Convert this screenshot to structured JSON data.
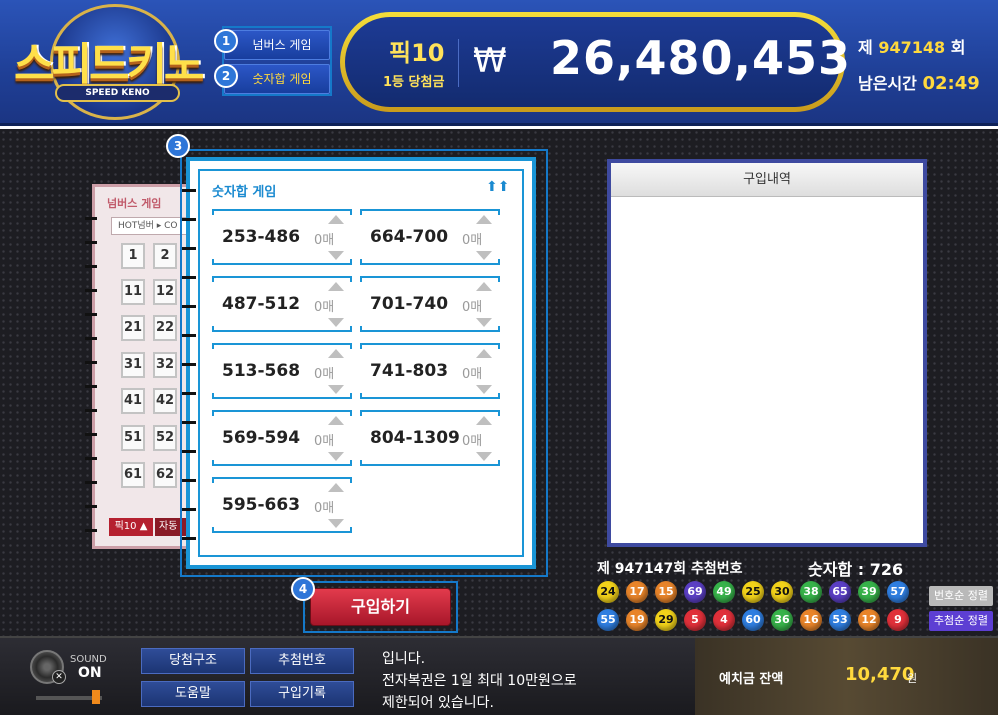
{
  "header": {
    "logo_title": "스피드키노",
    "logo_sub": "SPEED KENO",
    "modes": [
      {
        "badge": "1",
        "label": "넘버스 게임",
        "active": false
      },
      {
        "badge": "2",
        "label": "숫자합 게임",
        "active": true
      }
    ],
    "jackpot": {
      "label": "픽10",
      "sub_label": "1등 당첨금",
      "currency": "₩",
      "amount": "26,480,453"
    },
    "round_prefix": "제",
    "round_number": "947148",
    "round_suffix": "회",
    "time_label": "남은시간",
    "time_value": "02:49"
  },
  "number_slip": {
    "title": "넘버스 게임",
    "tab": "HOT넘버 ▸  CO",
    "rows": [
      [
        "1",
        "2"
      ],
      [
        "11",
        "12"
      ],
      [
        "21",
        "22"
      ],
      [
        "31",
        "32"
      ],
      [
        "41",
        "42"
      ],
      [
        "51",
        "52"
      ],
      [
        "61",
        "62"
      ]
    ],
    "foot_left": "픽10 ▲",
    "foot_right": "자동"
  },
  "sum_slip": {
    "badge": "3",
    "title": "숫자합 게임",
    "arrows": "⬆⬆",
    "count_suffix": "매",
    "ranges": [
      {
        "label": "253-486",
        "count": "0"
      },
      {
        "label": "664-700",
        "count": "0"
      },
      {
        "label": "487-512",
        "count": "0"
      },
      {
        "label": "701-740",
        "count": "0"
      },
      {
        "label": "513-568",
        "count": "0"
      },
      {
        "label": "741-803",
        "count": "0"
      },
      {
        "label": "569-594",
        "count": "0"
      },
      {
        "label": "804-1309",
        "count": "0"
      },
      {
        "label": "595-663",
        "count": "0"
      }
    ]
  },
  "buy": {
    "badge": "4",
    "label": "구입하기"
  },
  "history": {
    "title": "구입내역"
  },
  "draw": {
    "title": "제 947147회 추첨번호",
    "sum_label": "숫자합 : 726",
    "row1": [
      {
        "n": "24",
        "color": "#f2d21a"
      },
      {
        "n": "17",
        "color": "#e8842a"
      },
      {
        "n": "15",
        "color": "#e8842a"
      },
      {
        "n": "69",
        "color": "#5b3fc4"
      },
      {
        "n": "49",
        "color": "#37b24a"
      },
      {
        "n": "25",
        "color": "#f2d21a"
      },
      {
        "n": "30",
        "color": "#f2d21a"
      },
      {
        "n": "38",
        "color": "#37b24a"
      },
      {
        "n": "65",
        "color": "#5b3fc4"
      },
      {
        "n": "39",
        "color": "#37b24a"
      },
      {
        "n": "57",
        "color": "#2f7ee0"
      }
    ],
    "row2": [
      {
        "n": "55",
        "color": "#2f7ee0"
      },
      {
        "n": "19",
        "color": "#e8842a"
      },
      {
        "n": "29",
        "color": "#f2d21a"
      },
      {
        "n": "5",
        "color": "#e0303a"
      },
      {
        "n": "4",
        "color": "#e0303a"
      },
      {
        "n": "60",
        "color": "#2f7ee0"
      },
      {
        "n": "36",
        "color": "#37b24a"
      },
      {
        "n": "16",
        "color": "#e8842a"
      },
      {
        "n": "53",
        "color": "#2f7ee0"
      },
      {
        "n": "12",
        "color": "#e8842a"
      },
      {
        "n": "9",
        "color": "#e0303a"
      }
    ],
    "sort_number": "번호순 정렬",
    "sort_draw": "추첨순 정렬"
  },
  "footer": {
    "sound_label": "SOUND",
    "sound_value": "ON",
    "volume_level": 0.9,
    "buttons": [
      "당첨구조",
      "추첨번호",
      "도움말",
      "구입기록"
    ],
    "notice_lines": [
      "입니다.",
      "전자복권은 1일 최대 10만원으로",
      "제한되어 있습니다."
    ],
    "balance_label": "예치금 잔액",
    "balance_value": "10,470",
    "balance_unit": "원"
  }
}
